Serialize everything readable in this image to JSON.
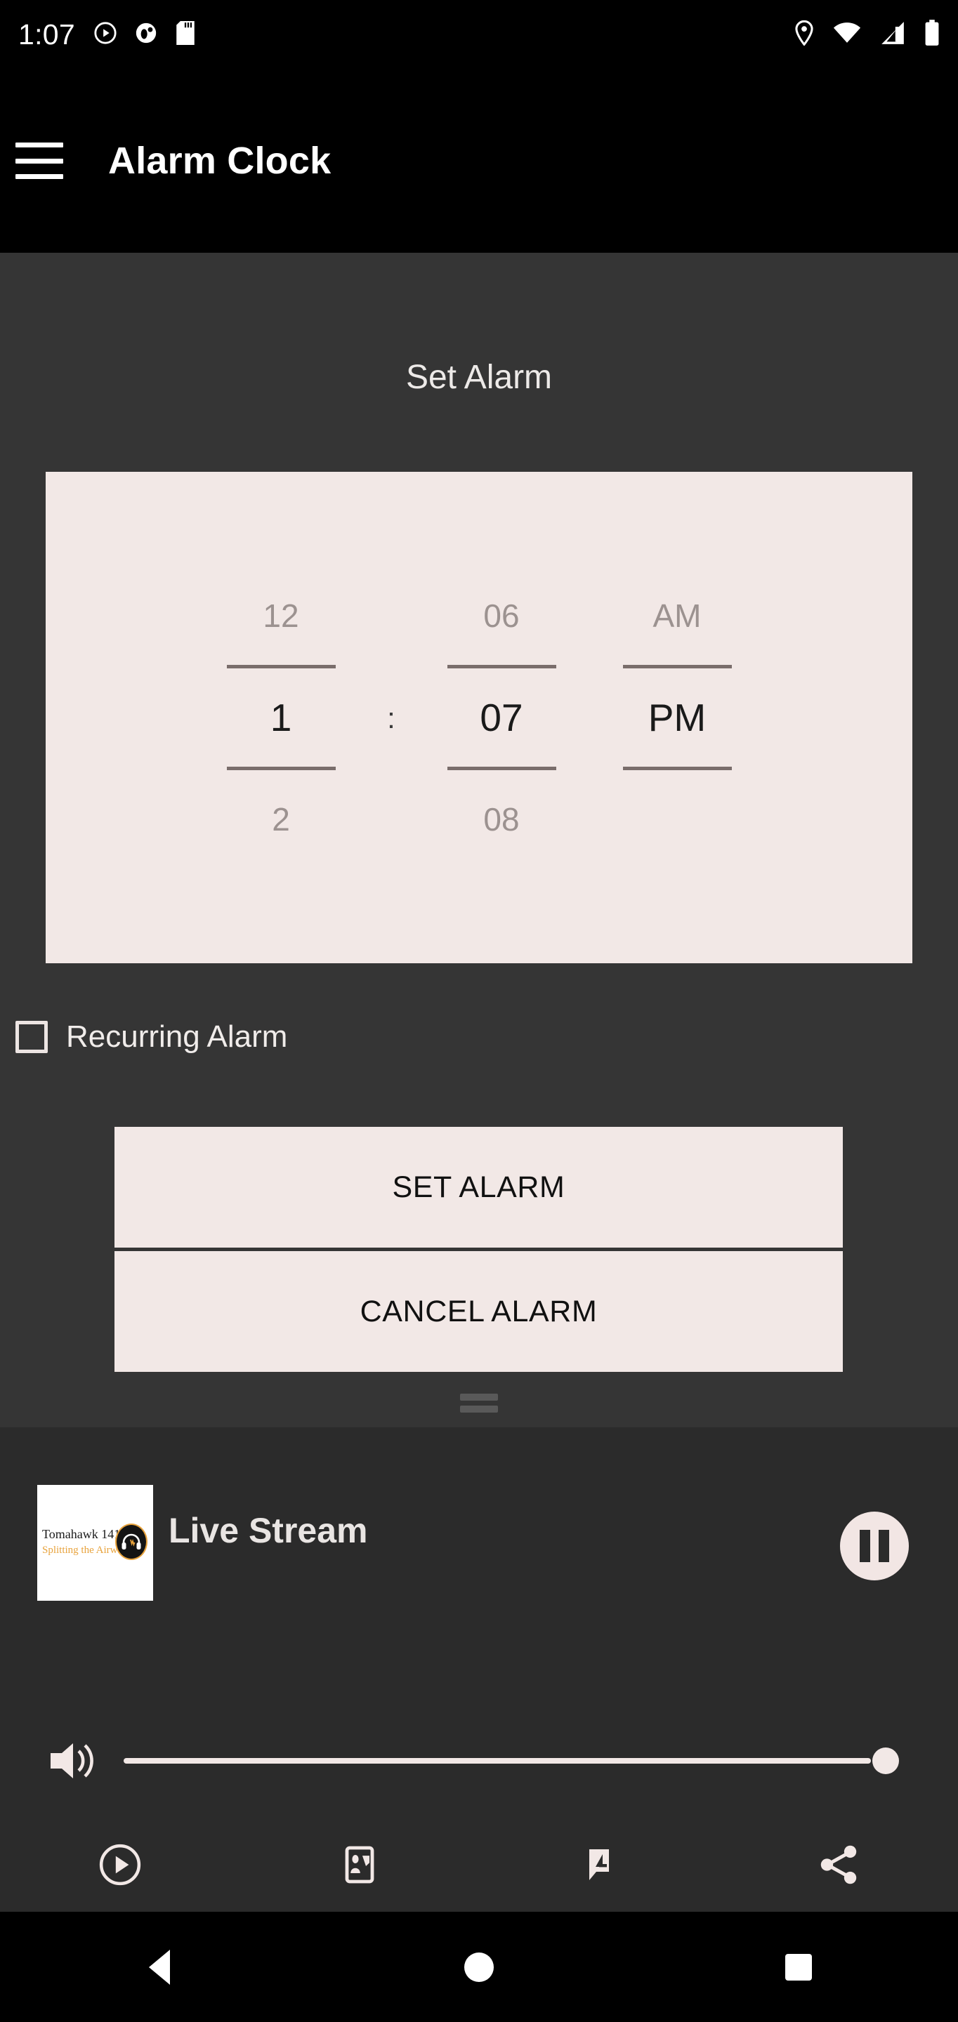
{
  "status_bar": {
    "time": "1:07",
    "left_icons": [
      "play-circle-icon",
      "app-notification-icon",
      "sd-card-icon"
    ],
    "right_icons": [
      "location-pin-icon",
      "wifi-icon",
      "cell-signal-icon",
      "battery-icon"
    ]
  },
  "app_bar": {
    "menu_icon": "hamburger-menu-icon",
    "title": "Alarm Clock"
  },
  "main": {
    "heading": "Set Alarm",
    "time_picker": {
      "hour": {
        "previous": "12",
        "selected": "1",
        "next": "2"
      },
      "minute": {
        "previous": "06",
        "selected": "07",
        "next": "08"
      },
      "meridiem": {
        "previous": "AM",
        "selected": "PM",
        "next": ""
      },
      "separator": ":"
    },
    "recurring": {
      "label": "Recurring Alarm",
      "checked": false
    },
    "buttons": {
      "set": "SET ALARM",
      "cancel": "CANCEL ALARM"
    },
    "drag_handle": "bottom-sheet-drag-handle"
  },
  "player": {
    "album_art": {
      "line1": "Tomahawk 141",
      "line2": "Splitting the Airwaves",
      "logo": "headphones-icon"
    },
    "track_title": "Live Stream",
    "playback_button": "pause-icon",
    "volume": {
      "icon": "volume-up-icon",
      "value": 100
    },
    "actions": [
      "play-circle-icon",
      "contact-card-icon",
      "feedback-message-icon",
      "share-icon"
    ]
  },
  "nav_bar": {
    "back": "back-triangle-icon",
    "home": "home-circle-icon",
    "recents": "recents-square-icon"
  },
  "colors": {
    "accent_panel": "#F2E8E6",
    "content_bg": "#353535",
    "player_bg": "#2B2B2B",
    "system_bg": "#000000",
    "logo_orange": "#E8A33D"
  }
}
